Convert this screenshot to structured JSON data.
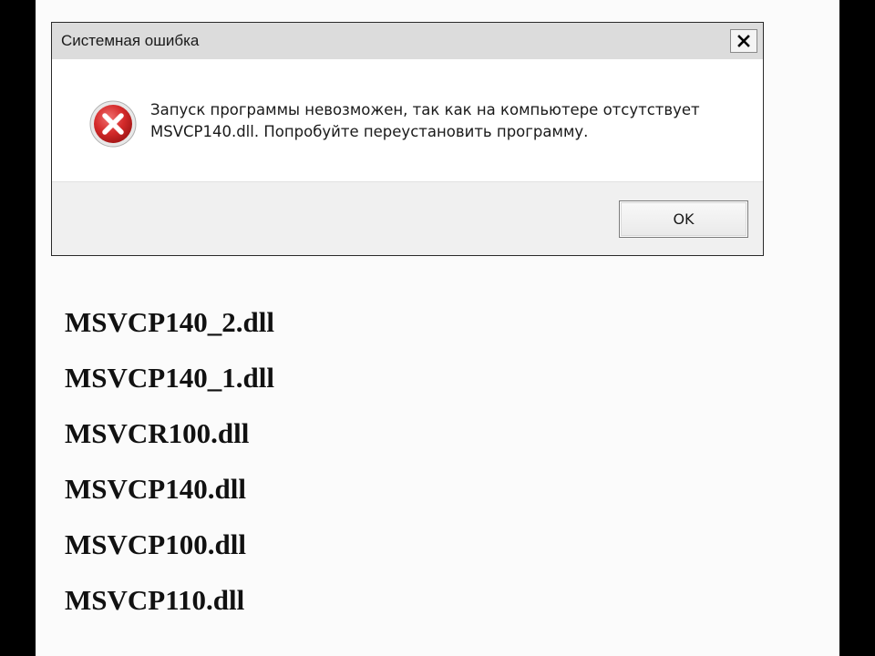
{
  "dialog": {
    "title": "Системная ошибка",
    "close_icon": "close-icon",
    "status_icon": "error-icon",
    "message_line1": "Запуск программы невозможен, так как на компьютере отсутствует",
    "message_line2": "MSVCP140.dll. Попробуйте переустановить программу.",
    "ok_label": "OK"
  },
  "dll_files": [
    "MSVCP140_2.dll",
    "MSVCP140_1.dll",
    "MSVCR100.dll",
    "MSVCP140.dll",
    "MSVCP100.dll",
    "MSVCP110.dll"
  ],
  "colors": {
    "error_red": "#c62828",
    "titlebar": "#dcdcdc",
    "footer": "#f0f0f0",
    "background": "#fbfbfb"
  }
}
